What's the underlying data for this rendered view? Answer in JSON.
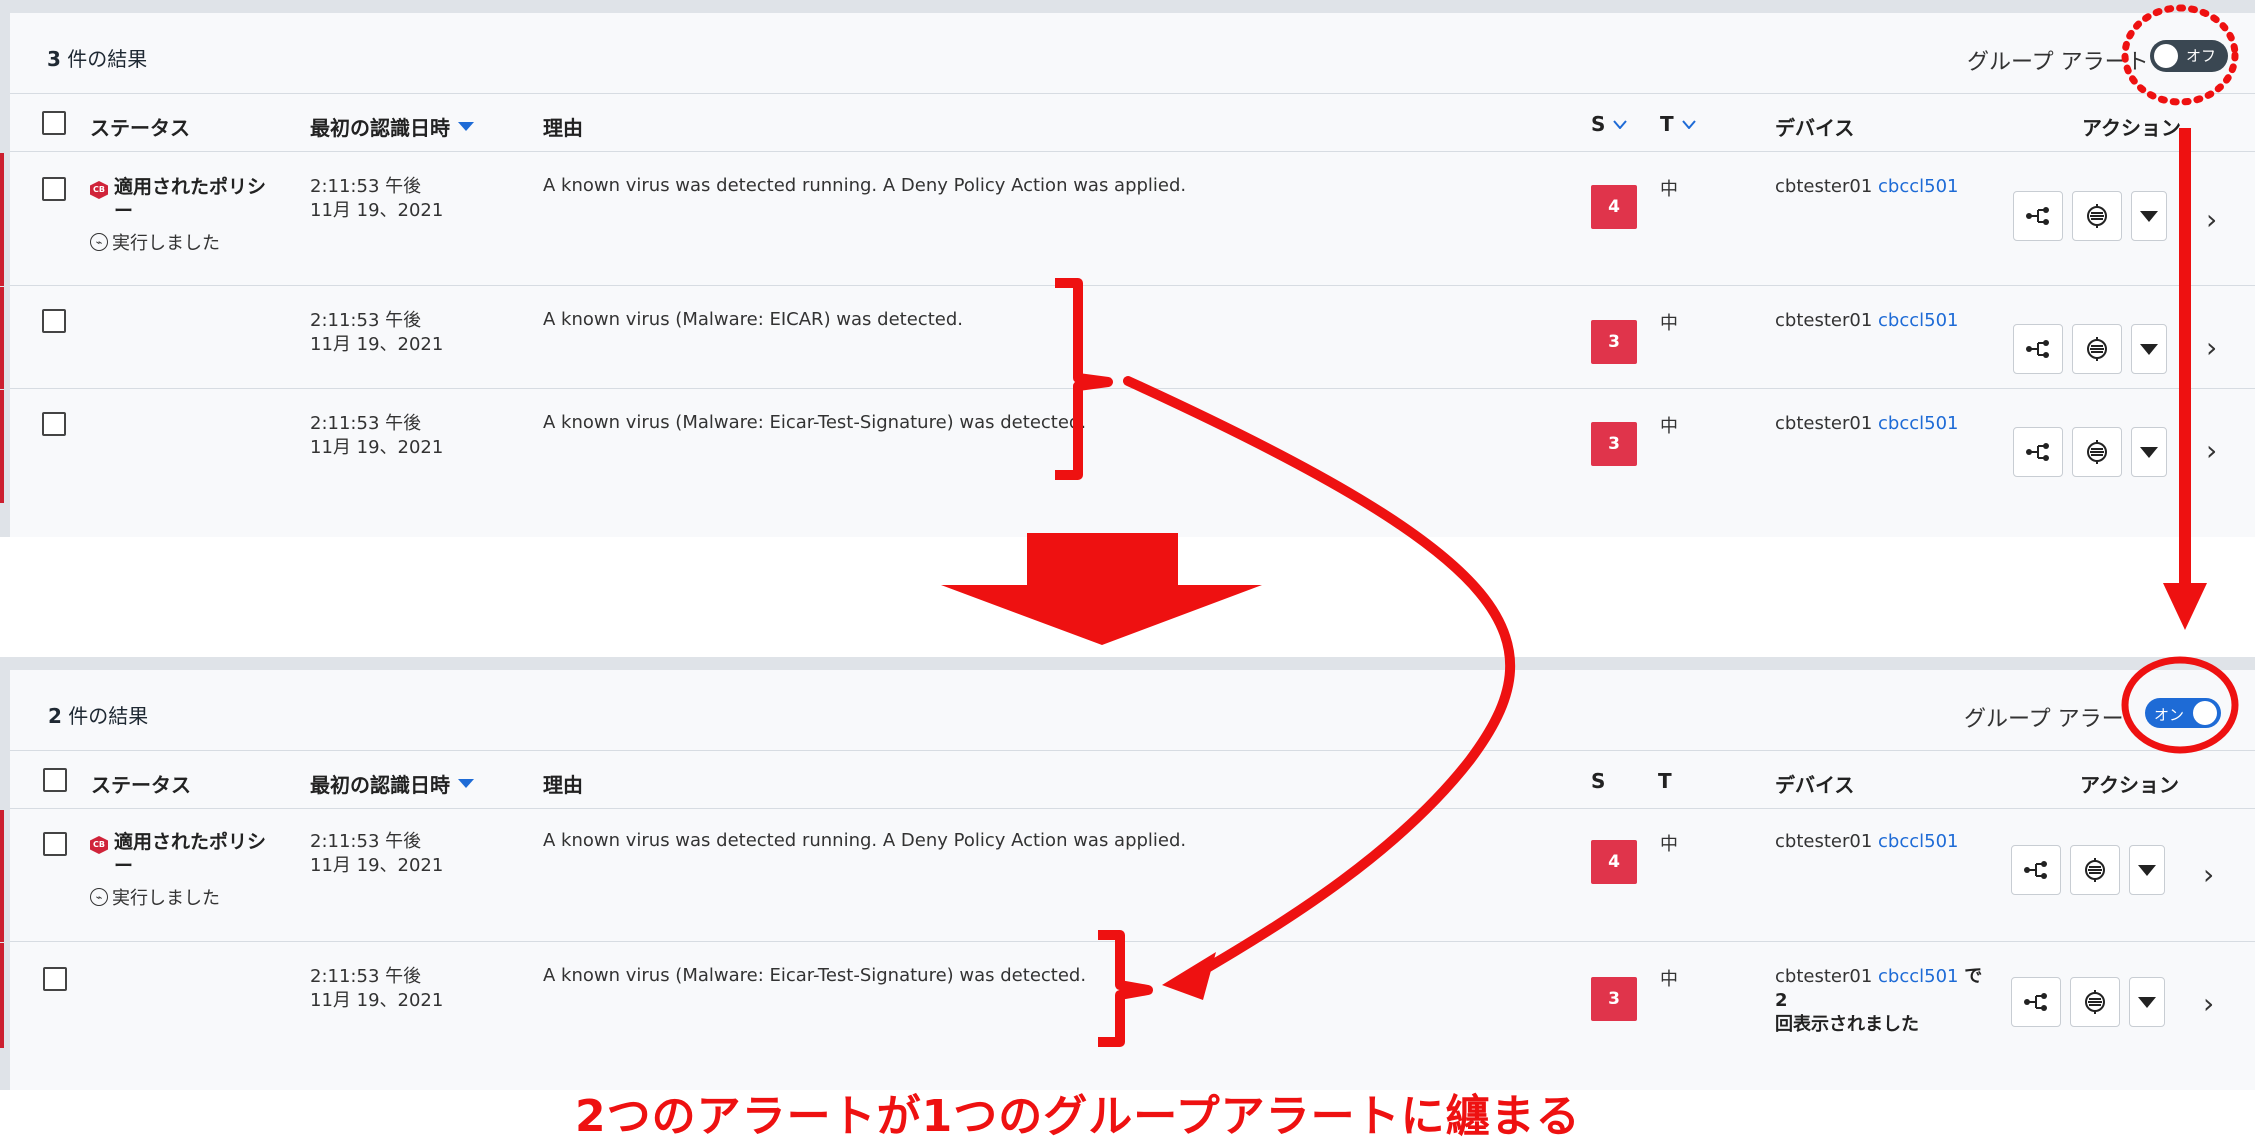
{
  "colors": {
    "accent": "#1e6bd6",
    "severity": "#e0344b",
    "alert_bar": "#cc1f2f",
    "annotation": "#ee1111",
    "toggle_off": "#3a4752"
  },
  "top": {
    "results": {
      "count": "3",
      "suffix": "件の結果"
    },
    "group_alert": {
      "label": "グループ アラート",
      "toggle_text": "オフ",
      "state": "off"
    },
    "headers": {
      "status": "ステータス",
      "first_seen": "最初の認識日時",
      "reason": "理由",
      "severity": "S",
      "threat": "T",
      "device": "デバイス",
      "actions": "アクション"
    },
    "rows": [
      {
        "status": "適用されたポリシー",
        "badge": "CB",
        "executed": "実行しました",
        "time": "2:11:53 午後",
        "date": "11月 19、2021",
        "reason": "A known virus was detected running. A Deny Policy Action was applied.",
        "severity": "4",
        "threat": "中",
        "device_user": "cbtester01",
        "device_link": "cbccl501"
      },
      {
        "time": "2:11:53 午後",
        "date": "11月 19、2021",
        "reason": "A known virus (Malware: EICAR) was detected.",
        "severity": "3",
        "threat": "中",
        "device_user": "cbtester01",
        "device_link": "cbccl501"
      },
      {
        "time": "2:11:53 午後",
        "date": "11月 19、2021",
        "reason": "A known virus (Malware: Eicar-Test-Signature) was detected.",
        "severity": "3",
        "threat": "中",
        "device_user": "cbtester01",
        "device_link": "cbccl501"
      }
    ]
  },
  "bottom": {
    "results": {
      "count": "2",
      "suffix": "件の結果"
    },
    "group_alert": {
      "label": "グループ アラー",
      "toggle_text": "オン",
      "state": "on"
    },
    "headers": {
      "status": "ステータス",
      "first_seen": "最初の認識日時",
      "reason": "理由",
      "severity": "S",
      "threat": "T",
      "device": "デバイス",
      "actions": "アクション"
    },
    "rows": [
      {
        "status": "適用されたポリシー",
        "badge": "CB",
        "executed": "実行しました",
        "time": "2:11:53 午後",
        "date": "11月 19、2021",
        "reason": "A known virus was detected running. A Deny Policy Action was applied.",
        "severity": "4",
        "threat": "中",
        "device_user": "cbtester01",
        "device_link": "cbccl501"
      },
      {
        "time": "2:11:53 午後",
        "date": "11月 19、2021",
        "reason": "A known virus (Malware: Eicar-Test-Signature) was detected.",
        "severity": "3",
        "threat": "中",
        "device_user": "cbtester01",
        "device_link": "cbccl501",
        "device_suffix": "で 2",
        "device_note": "回表示されました"
      }
    ]
  },
  "caption": "2つのアラートが1つのグループアラートに纏まる",
  "icons": {
    "process_tree": "process-tree-icon",
    "investigate": "investigate-icon",
    "dropdown": "caret-down-icon",
    "row_open": "chevron-right-icon",
    "executed": "pulse-icon"
  }
}
